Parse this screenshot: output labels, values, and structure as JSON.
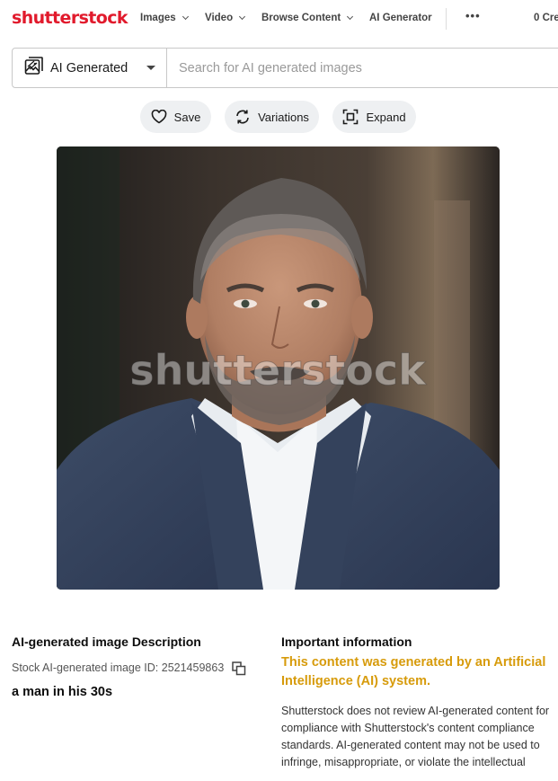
{
  "nav": {
    "logo": "shutterstock",
    "items": [
      {
        "label": "Images",
        "has_dropdown": true
      },
      {
        "label": "Video",
        "has_dropdown": true
      },
      {
        "label": "Browse Content",
        "has_dropdown": true
      },
      {
        "label": "AI Generator",
        "has_dropdown": false
      }
    ],
    "more_label": "•••",
    "credits_label": "0 Cre"
  },
  "search": {
    "type_label": "AI Generated",
    "placeholder": "Search for AI generated images",
    "value": ""
  },
  "actions": {
    "save_label": "Save",
    "variations_label": "Variations",
    "expand_label": "Expand"
  },
  "image": {
    "watermark": "shutterstock"
  },
  "description": {
    "heading": "AI-generated image Description",
    "image_id": "Stock AI-generated image ID: 2521459863",
    "caption": "a man in his 30s"
  },
  "important": {
    "heading": "Important information",
    "ai_notice": "This content was generated by an Artificial Intelligence (AI) system.",
    "disclaimer": "Shutterstock does not review AI-generated content for compliance with Shutterstock's content compliance standards. AI-generated content may not be used to infringe, misappropriate, or violate the intellectual"
  },
  "colors": {
    "brand": "#e11a2c",
    "ai_notice": "#d79b0b",
    "pill_bg": "#eef0f2"
  },
  "icons": {
    "ai_generated": "ai-image-icon",
    "save": "heart-icon",
    "variations": "refresh-icon",
    "expand": "expand-icon",
    "copy": "copy-icon"
  }
}
